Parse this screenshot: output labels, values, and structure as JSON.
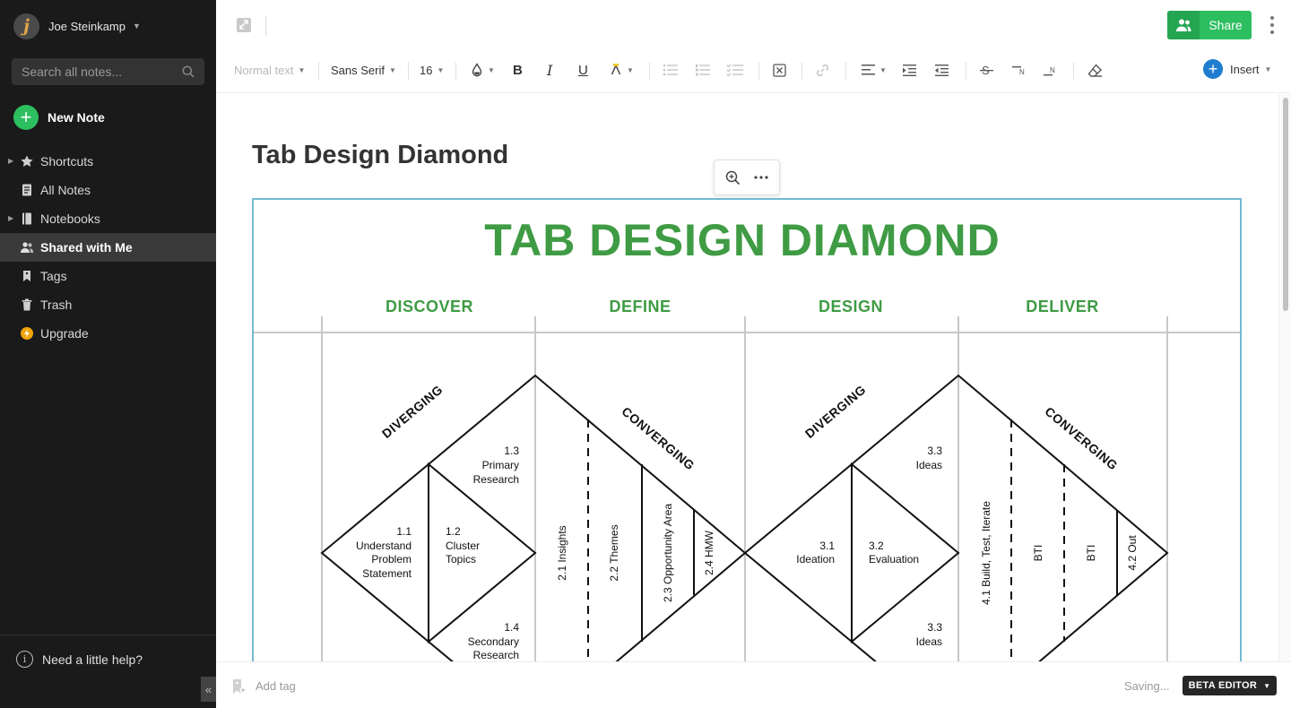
{
  "user": {
    "name": "Joe Steinkamp",
    "avatar_letter": "j"
  },
  "search": {
    "placeholder": "Search all notes..."
  },
  "new_note": {
    "label": "New Note",
    "plus": "+"
  },
  "nav": {
    "items": [
      {
        "label": "Shortcuts",
        "icon": "star-icon"
      },
      {
        "label": "All Notes",
        "icon": "notes-icon"
      },
      {
        "label": "Notebooks",
        "icon": "notebook-icon"
      },
      {
        "label": "Shared with Me",
        "icon": "shared-icon"
      },
      {
        "label": "Tags",
        "icon": "tag-icon"
      },
      {
        "label": "Trash",
        "icon": "trash-icon"
      },
      {
        "label": "Upgrade",
        "icon": "upgrade-icon"
      }
    ],
    "active": "Shared with Me"
  },
  "help": {
    "label": "Need a little help?",
    "icon_glyph": "i"
  },
  "collapse": {
    "glyph": "«"
  },
  "topbar": {
    "share_label": "Share"
  },
  "toolbar": {
    "paragraph_style": "Normal text",
    "font_family": "Sans Serif",
    "font_size": "16",
    "insert_label": "Insert"
  },
  "note": {
    "title": "Tab Design Diamond",
    "image_text": {
      "heading": "TAB DESIGN DIAMOND",
      "phases": [
        "DISCOVER",
        "DEFINE",
        "DESIGN",
        "DELIVER"
      ],
      "diverging": "DIVERGING",
      "converging": "CONVERGING",
      "s11": [
        "1.1",
        "Understand",
        "Problem",
        "Statement"
      ],
      "s12": [
        "1.2",
        "Cluster",
        "Topics"
      ],
      "s13": [
        "1.3",
        "Primary",
        "Research"
      ],
      "s14": [
        "1.4",
        "Secondary",
        "Research"
      ],
      "s21": "2.1 Insights",
      "s22": "2.2 Themes",
      "s23": "2.3 Opportunity Area",
      "s24": "2.4 HMW",
      "s31": [
        "3.1",
        "Ideation"
      ],
      "s32": [
        "3.2",
        "Evaluation"
      ],
      "s33_top": [
        "3.3",
        "Ideas"
      ],
      "s33_bottom": [
        "3.3",
        "Ideas"
      ],
      "s41": "4.1 Build, Test, Iterate",
      "bti_1": "BTI",
      "bti_2": "BTI",
      "s42": "4.2 Out"
    },
    "colors": {
      "heading_green": "#3f9b44",
      "frame_blue": "#74b9d3"
    }
  },
  "footer": {
    "add_tag": "Add tag",
    "status": "Saving...",
    "beta_label": "BETA EDITOR"
  },
  "colors": {
    "sidebar_bg": "#1a1a1a",
    "accent_green": "#2dbe60",
    "insert_blue": "#1f7dcf"
  }
}
